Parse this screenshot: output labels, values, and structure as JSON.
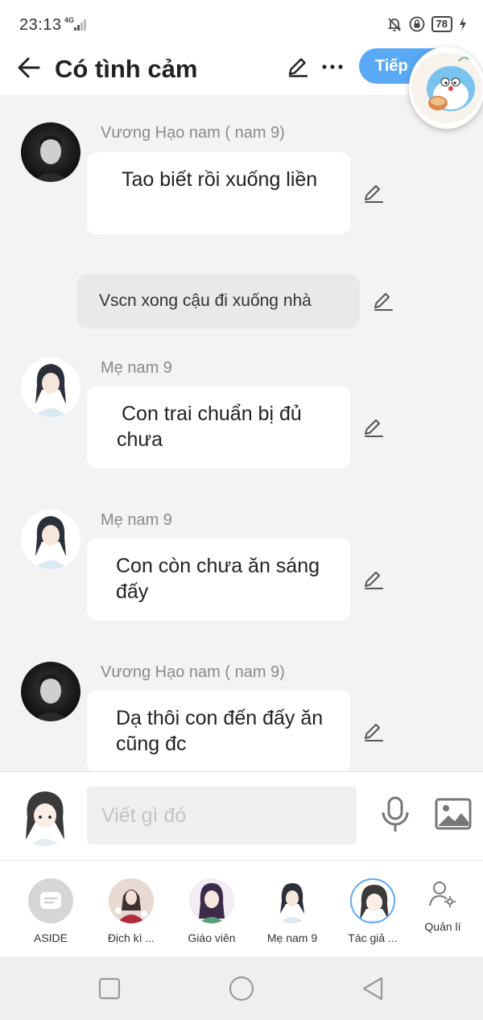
{
  "status_bar": {
    "time": "23:13",
    "network": "4G",
    "battery": "78",
    "icons": [
      "mute-bell-icon",
      "lock-icon",
      "charging-icon"
    ]
  },
  "header": {
    "title": "Có tình cảm",
    "next_label": "Tiếp",
    "icons": [
      "back-arrow-icon",
      "pencil-icon",
      "more-icon"
    ]
  },
  "messages": [
    {
      "sender": "Vương Hạo nam ( nam 9)",
      "text": " Tao biết rồi xuống liền",
      "avatar": "dark"
    },
    {
      "narration": "Vscn xong cậu đi xuống nhà"
    },
    {
      "sender": "Mẹ nam 9",
      "text": " Con trai chuẩn bị đủ chưa",
      "avatar": "light"
    },
    {
      "sender": "Mẹ nam 9",
      "text": "Con còn chưa ăn sáng đấy",
      "avatar": "light"
    },
    {
      "sender": "Vương Hạo nam ( nam 9)",
      "text": "Dạ thôi con đến đấy ăn cũng đc",
      "avatar": "dark"
    }
  ],
  "composer": {
    "placeholder": "Viết gì đó",
    "icons": [
      "mic-icon",
      "image-icon"
    ]
  },
  "characters": [
    {
      "label": "ASIDE"
    },
    {
      "label": "Địch kì ..."
    },
    {
      "label": "Giáo viên"
    },
    {
      "label": "Mẹ nam 9"
    },
    {
      "label": "Tác giả ..."
    }
  ],
  "manage_label": "Quản lí",
  "colors": {
    "accent": "#5aa9f5",
    "background": "#f3f3f3",
    "bubble": "#ffffff",
    "narration": "#e9e9e9"
  }
}
